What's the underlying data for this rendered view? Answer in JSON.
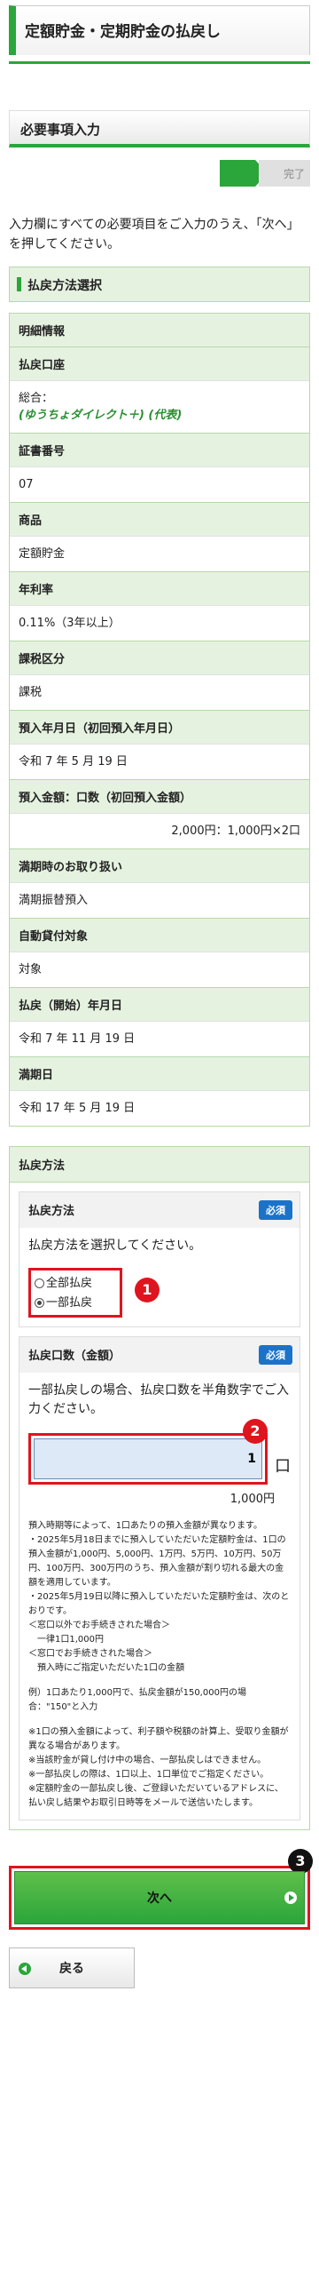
{
  "header": {
    "title": "定額貯金・定期貯金の払戻し"
  },
  "section": {
    "title": "必要事項入力"
  },
  "steps": {
    "done_label": "完了"
  },
  "intro": "入力欄にすべての必要項目をご入力のうえ、「次へ」を押してください。",
  "payout_method_heading": "払戻方法選択",
  "details": {
    "header": "明細情報",
    "rows": [
      {
        "label": "払戻口座",
        "value_lines": [
          "総合：",
          "(ゆうちょダイレクト＋) (代表)"
        ]
      },
      {
        "label": "証書番号",
        "value": "07"
      },
      {
        "label": "商品",
        "value": "定額貯金"
      },
      {
        "label": "年利率",
        "value": "0.11%（3年以上）"
      },
      {
        "label": "課税区分",
        "value": "課税"
      },
      {
        "label": "預入年月日（初回預入年月日）",
        "value": "令和 7 年 5 月 19 日"
      },
      {
        "label": "預入金額：口数（初回預入金額）",
        "value": "2,000円：1,000円×2口"
      },
      {
        "label": "満期時のお取り扱い",
        "value": "満期振替預入"
      },
      {
        "label": "自動貸付対象",
        "value": "対象"
      },
      {
        "label": "払戻（開始）年月日",
        "value": "令和 7 年 11 月 19 日"
      },
      {
        "label": "満期日",
        "value": "令和 17 年 5 月 19 日"
      }
    ]
  },
  "method": {
    "header": "払戻方法",
    "label": "払戻方法",
    "required": "必須",
    "instruction": "払戻方法を選択してください。",
    "options": [
      "全部払戻",
      "一部払戻"
    ],
    "selected": "一部払戻"
  },
  "amount": {
    "label": "払戻口数（金額）",
    "required": "必須",
    "instruction": "一部払戻しの場合、払戻口数を半角数字でご入力ください。",
    "value": "1",
    "unit": "口",
    "yen": "1,000円",
    "notes": [
      "預入時期等によって、1口あたりの預入金額が異なります。",
      "・2025年5月18日までに預入していただいた定額貯金は、1口の預入金額が1,000円、5,000円、1万円、5万円、10万円、50万円、100万円、300万円のうち、預入金額が割り切れる最大の金額を適用しています。",
      "・2025年5月19日以降に預入していただいた定額貯金は、次のとおりです。",
      "＜窓口以外でお手続きされた場合＞",
      "　一律1口1,000円",
      "＜窓口でお手続きされた場合＞",
      "　預入時にご指定いただいた1口の金額",
      "",
      "例）1口あたり1,000円で、払戻金額が150,000円の場合：\"150\"と入力",
      "",
      "※1口の預入金額によって、利子額や税額の計算上、受取り金額が異なる場合があります。",
      "※当該貯金が貸し付け中の場合、一部払戻しはできません。",
      "※一部払戻しの際は、1口以上、1口単位でご指定ください。",
      "※定額貯金の一部払戻し後、ご登録いただいているアドレスに、払い戻し結果やお取引日時等をメールで送信いたします。"
    ]
  },
  "markers": [
    "1",
    "2",
    "3"
  ],
  "buttons": {
    "next": "次へ",
    "back": "戻る"
  }
}
